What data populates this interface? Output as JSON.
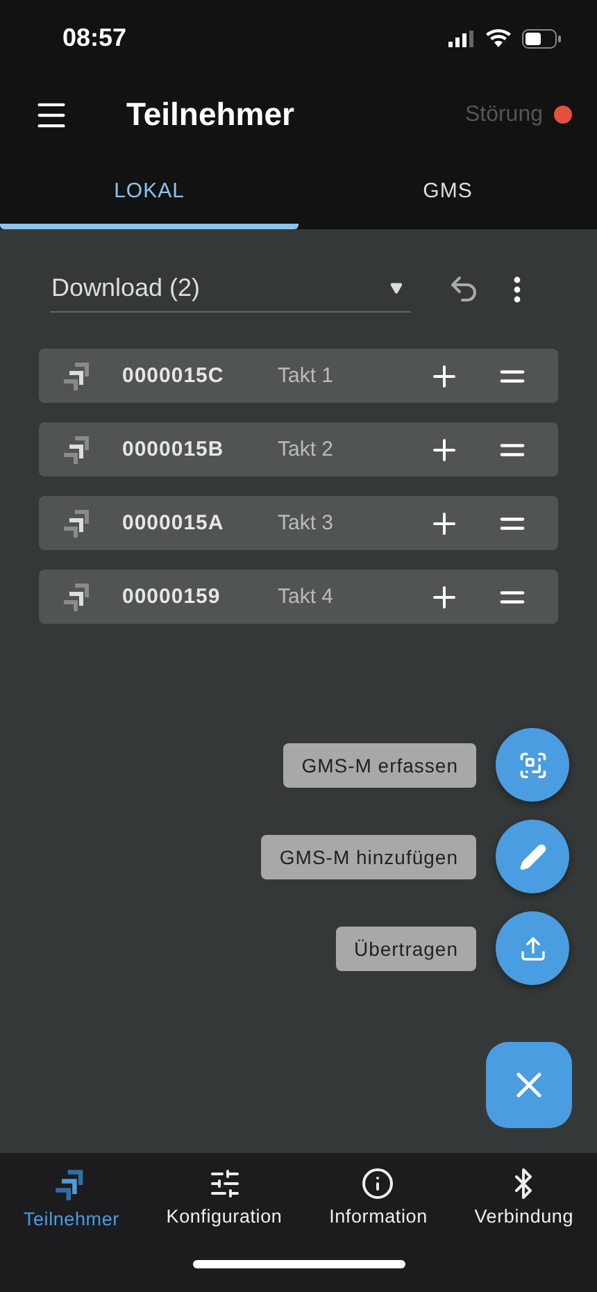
{
  "status_bar": {
    "time": "08:57"
  },
  "app_bar": {
    "title": "Teilnehmer",
    "status_label": "Störung",
    "fault": true
  },
  "tabs": [
    {
      "label": "LOKAL",
      "selected": true
    },
    {
      "label": "GMS",
      "selected": false
    }
  ],
  "dropdown": {
    "value": "Download (2)"
  },
  "devices": [
    {
      "id": "0000015C",
      "step": "Takt 1"
    },
    {
      "id": "0000015B",
      "step": "Takt 2"
    },
    {
      "id": "0000015A",
      "step": "Takt 3"
    },
    {
      "id": "00000159",
      "step": "Takt 4"
    }
  ],
  "speed_dial": [
    {
      "kind": "scan",
      "label": "GMS-M erfassen"
    },
    {
      "kind": "edit",
      "label": "GMS-M hinzufügen"
    },
    {
      "kind": "upload",
      "label": "Übertragen"
    }
  ],
  "bottom_nav": [
    {
      "kind": "participants",
      "label": "Teilnehmer",
      "selected": true
    },
    {
      "kind": "config",
      "label": "Konfiguration",
      "selected": false
    },
    {
      "kind": "info",
      "label": "Information",
      "selected": false
    },
    {
      "kind": "bluetooth",
      "label": "Verbindung",
      "selected": false
    }
  ]
}
